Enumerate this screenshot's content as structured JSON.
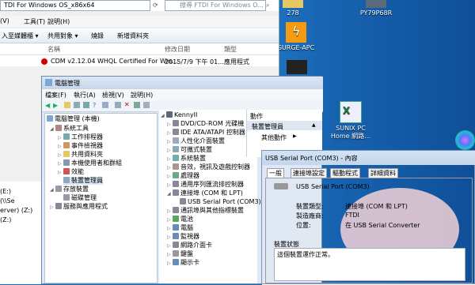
{
  "colors": {
    "desktop": "#1a6bb5",
    "highlight": "#f5d2d7",
    "red_icon": "#d00000"
  },
  "desktop_icons": [
    {
      "label": "278",
      "icon": "folder-icon"
    },
    {
      "label": "PY79P68R",
      "icon": "computer-icon"
    },
    {
      "label": "SURGE-APC",
      "icon": "lightning-app-icon"
    },
    {
      "label": "SUNIX PC Home 網路…",
      "icon": "excel-file-icon"
    }
  ],
  "explorer": {
    "path": "TDI For Windows OS_x86x64",
    "search_placeholder": "搜尋 FTDI For Windows O...",
    "menu": [
      "工具(T)",
      "說明(H)"
    ],
    "menu_left_partial": "(V)",
    "toolbar": [
      "入至媒體櫃 ▾",
      "共用對象 ▾",
      "燒錄",
      "新增資料夾"
    ],
    "header": [
      "名稱",
      "修改日期",
      "類型"
    ],
    "file": {
      "name": "CDM v2.12.04 WHQL Certified For Win...",
      "date": "2015/7/9 下午 01...",
      "type": "應用程式"
    },
    "left_items": [
      "(E:)",
      "(\\\\Se",
      "erver) (Z:)",
      "(Z:)"
    ]
  },
  "devmgr": {
    "title": "電腦管理",
    "menu": [
      "檔案(F)",
      "執行(A)",
      "檢視(V)",
      "說明(H)"
    ],
    "left_tree": [
      {
        "label": "電腦管理 (本機)",
        "level": 0
      },
      {
        "label": "系統工具",
        "level": 1
      },
      {
        "label": "工作排程器",
        "level": 2
      },
      {
        "label": "事件檢視器",
        "level": 2
      },
      {
        "label": "共用資料夾",
        "level": 2
      },
      {
        "label": "本機使用者和群組",
        "level": 2
      },
      {
        "label": "效能",
        "level": 2
      },
      {
        "label": "裝置管理員",
        "level": 2
      },
      {
        "label": "存放裝置",
        "level": 1
      },
      {
        "label": "磁碟管理",
        "level": 2
      },
      {
        "label": "服務與應用程式",
        "level": 1
      }
    ],
    "right_tree": [
      {
        "label": "KennyII",
        "level": 0
      },
      {
        "label": "DVD/CD-ROM 光碟機",
        "level": 1
      },
      {
        "label": "IDE ATA/ATAPI 控制器",
        "level": 1
      },
      {
        "label": "人性化介面裝置",
        "level": 1
      },
      {
        "label": "可攜式裝置",
        "level": 1
      },
      {
        "label": "系統裝置",
        "level": 1
      },
      {
        "label": "音效，視訊及遊戲控制器",
        "level": 1
      },
      {
        "label": "處理器",
        "level": 1
      },
      {
        "label": "通用序列匯流排控制器",
        "level": 1
      },
      {
        "label": "連接埠 (COM 和 LPT)",
        "level": 1
      },
      {
        "label": "USB Serial Port (COM3)",
        "level": 2
      },
      {
        "label": "通訊埠與其他指標裝置",
        "level": 1
      },
      {
        "label": "電池",
        "level": 1
      },
      {
        "label": "電腦",
        "level": 1
      },
      {
        "label": "監視器",
        "level": 1
      },
      {
        "label": "網路介面卡",
        "level": 1
      },
      {
        "label": "鍵盤",
        "level": 1
      },
      {
        "label": "顯示卡",
        "level": 1
      }
    ],
    "actions_title": "動作",
    "actions": [
      "裝置管理員",
      "其他動作"
    ]
  },
  "props": {
    "title": "USB Serial Port (COM3) - 內容",
    "tabs": [
      "一般",
      "連接埠設定",
      "驅動程式",
      "詳細資料"
    ],
    "device_name": "USB Serial Port (COM3)",
    "rows": [
      {
        "label": "裝置類型:",
        "value": "連接埠 (COM 和 LPT)"
      },
      {
        "label": "製造廠商:",
        "value": "FTDI"
      },
      {
        "label": "位置:",
        "value": "在 USB Serial Converter"
      }
    ],
    "status_heading": "裝置狀態",
    "status_text": "這個裝置運作正常。"
  }
}
